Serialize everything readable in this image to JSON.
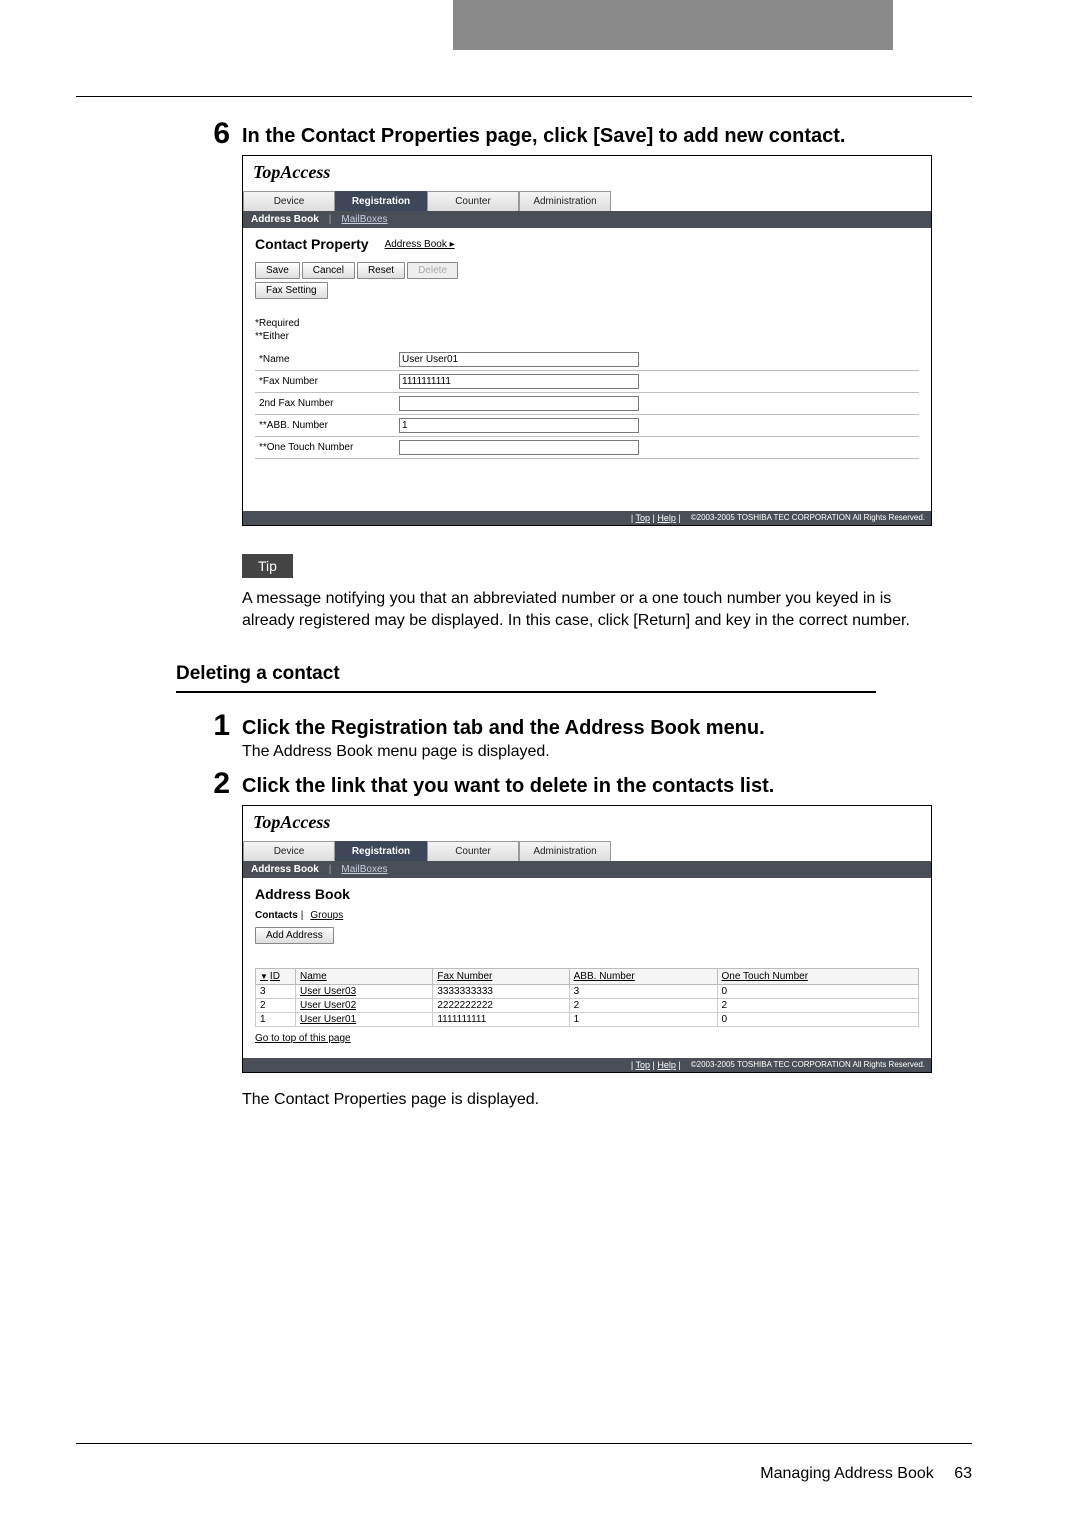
{
  "step6": {
    "number": "6",
    "title": "In the Contact Properties page, click [Save] to add new contact."
  },
  "shot1": {
    "logo": "TopAccess",
    "nav": {
      "device": "Device",
      "registration": "Registration",
      "counter": "Counter",
      "administration": "Administration"
    },
    "subnav": {
      "active": "Address Book",
      "link": "MailBoxes"
    },
    "heading": "Contact Property",
    "breadcrumb": "Address Book ▸",
    "buttons": {
      "save": "Save",
      "cancel": "Cancel",
      "reset": "Reset",
      "delete": "Delete",
      "faxSetting": "Fax Setting"
    },
    "legend1": "*Required",
    "legend2": "**Either",
    "fields": {
      "name": {
        "label": "*Name",
        "value": "User User01"
      },
      "fax": {
        "label": "*Fax Number",
        "value": "1111111111"
      },
      "fax2": {
        "label": "2nd Fax Number",
        "value": ""
      },
      "abb": {
        "label": "**ABB. Number",
        "value": "1"
      },
      "ot": {
        "label": "**One Touch Number",
        "value": ""
      }
    },
    "footer": {
      "top": "Top",
      "help": "Help",
      "copy": "©2003-2005 TOSHIBA TEC CORPORATION All Rights Reserved."
    }
  },
  "tip": {
    "label": "Tip",
    "text": "A message notifying you that an abbreviated number or a one touch number you keyed in is already registered may be displayed. In this case, click [Return] and key in the correct number."
  },
  "sectionDeleting": "Deleting a contact",
  "step1": {
    "number": "1",
    "title": "Click the Registration tab and the Address Book menu.",
    "sub": "The Address Book menu page is displayed."
  },
  "step2": {
    "number": "2",
    "title": "Click the link that you want to delete in the contacts list."
  },
  "shot2": {
    "logo": "TopAccess",
    "nav": {
      "device": "Device",
      "registration": "Registration",
      "counter": "Counter",
      "administration": "Administration"
    },
    "subnav": {
      "active": "Address Book",
      "link": "MailBoxes"
    },
    "heading": "Address Book",
    "contacts": "Contacts",
    "groups": "Groups",
    "addAddress": "Add Address",
    "columns": {
      "id": "ID",
      "name": "Name",
      "fax": "Fax Number",
      "abb": "ABB. Number",
      "ot": "One Touch Number"
    },
    "rows": [
      {
        "id": "3",
        "name": "User User03",
        "fax": "3333333333",
        "abb": "3",
        "ot": "0"
      },
      {
        "id": "2",
        "name": "User User02",
        "fax": "2222222222",
        "abb": "2",
        "ot": "2"
      },
      {
        "id": "1",
        "name": "User User01",
        "fax": "1111111111",
        "abb": "1",
        "ot": "0"
      }
    ],
    "goTop": "Go to top of this page",
    "footer": {
      "top": "Top",
      "help": "Help",
      "copy": "©2003-2005 TOSHIBA TEC CORPORATION All Rights Reserved."
    }
  },
  "afterShot2": "The Contact Properties page is displayed.",
  "pageFooter": {
    "section": "Managing Address Book",
    "page": "63"
  }
}
